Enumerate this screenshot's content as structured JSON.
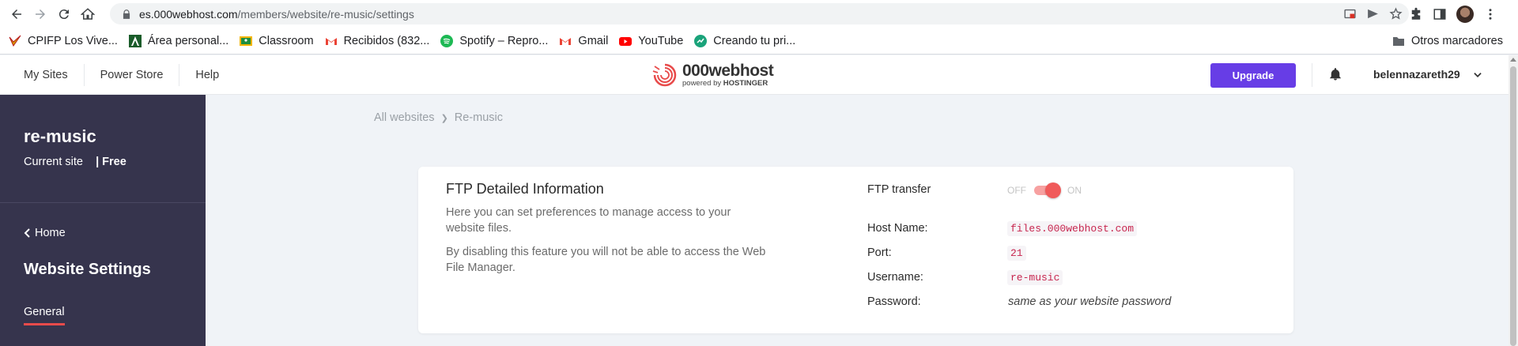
{
  "browser": {
    "url_host": "es.000webhost.com",
    "url_path": "/members/website/re-music/settings",
    "bookmarks": [
      {
        "label": "CPIFP Los Vive...",
        "icon": "cpifp-icon",
        "color": "#d6a100"
      },
      {
        "label": "Área personal...",
        "icon": "area-personal-icon",
        "color": "#1a5c2a"
      },
      {
        "label": "Classroom",
        "icon": "classroom-icon",
        "color": "#f4b400"
      },
      {
        "label": "Recibidos (832...",
        "icon": "gmail-icon",
        "color": "#ea4335"
      },
      {
        "label": "Spotify – Repro...",
        "icon": "spotify-icon",
        "color": "#1db954"
      },
      {
        "label": "Gmail",
        "icon": "gmail-icon",
        "color": "#ea4335"
      },
      {
        "label": "YouTube",
        "icon": "youtube-icon",
        "color": "#ff0000"
      },
      {
        "label": "Creando tu pri...",
        "icon": "creando-icon",
        "color": "#1aa37a"
      }
    ],
    "other_bookmarks": "Otros marcadores"
  },
  "header": {
    "nav": [
      "My Sites",
      "Power Store",
      "Help"
    ],
    "logo_main": "000webhost",
    "logo_sub_prefix": "powered by",
    "logo_sub_brand": "HOSTINGER",
    "upgrade_label": "Upgrade",
    "username": "belennazareth29",
    "accent": "#673de6"
  },
  "sidebar": {
    "site_name": "re-music",
    "current_site": "Current site",
    "plan": "| Free",
    "home": "Home",
    "settings_title": "Website Settings",
    "active_item": "General",
    "bg": "#36344d"
  },
  "breadcrumb": {
    "root": "All websites",
    "current": "Re-music"
  },
  "card": {
    "title": "FTP Detailed Information",
    "desc1": "Here you can set preferences to manage access to your website files.",
    "desc2": "By disabling this feature you will not be able to access the Web File Manager.",
    "ftp_label": "FTP transfer",
    "toggle_off": "OFF",
    "toggle_on": "ON",
    "toggle_state": "on",
    "host_label": "Host Name:",
    "host_value": "files.000webhost.com",
    "port_label": "Port:",
    "port_value": "21",
    "username_label": "Username:",
    "username_value": "re-music",
    "password_label": "Password:",
    "password_value": "same as your website password"
  }
}
